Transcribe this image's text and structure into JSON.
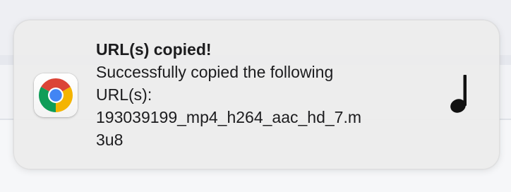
{
  "notification": {
    "app_icon": "chrome-logo-icon",
    "title": "URL(s) copied!",
    "body_lines": [
      "Successfully copied the following",
      "URL(s):",
      "193039199_mp4_h264_aac_hd_7.m",
      "3u8"
    ],
    "content_icon": "music-note-icon"
  },
  "colors": {
    "notification_bg": "#ececec",
    "text": "#1c1c1e",
    "chrome_red": "#db4437",
    "chrome_yellow": "#f4b400",
    "chrome_green": "#0f9d58",
    "chrome_blue": "#4285f4"
  }
}
